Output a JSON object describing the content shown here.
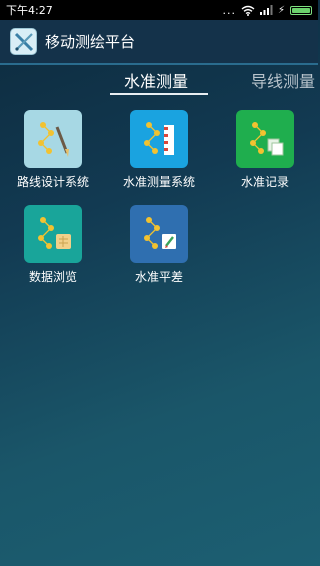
{
  "status_bar": {
    "time": "下午4:27",
    "dots": "..."
  },
  "app_bar": {
    "title": "移动测绘平台",
    "logo_icon": "ruler-pen-icon"
  },
  "tabs": [
    {
      "label": "水准测量",
      "active": true
    },
    {
      "label": "导线测量",
      "active": false
    }
  ],
  "tiles": [
    {
      "label": "路线设计系统",
      "icon": "route-design-icon",
      "color": "#a7d8e4"
    },
    {
      "label": "水准测量系统",
      "icon": "leveling-ruler-icon",
      "color": "#1aa3e0"
    },
    {
      "label": "水准记录",
      "icon": "record-copy-icon",
      "color": "#1fae4e"
    },
    {
      "label": "数据浏览",
      "icon": "data-browse-icon",
      "color": "#19a59a"
    },
    {
      "label": "水准平差",
      "icon": "adjustment-edit-icon",
      "color": "#2f6fb0"
    }
  ]
}
